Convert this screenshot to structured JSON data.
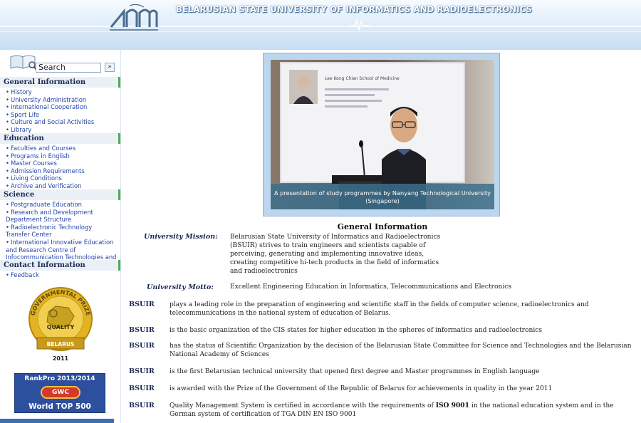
{
  "header": {
    "title": "BELARUSIAN STATE UNIVERSITY OF INFORMATICS AND RADIOELECTRONICS",
    "logo_icon": "bsuir-logo-icon"
  },
  "search": {
    "label": "Search",
    "go_label": "»"
  },
  "sidebar": {
    "sections": [
      {
        "title": "General Information",
        "items": [
          "History",
          "University Administration",
          "International Cooperation",
          "Sport Life",
          "Culture and Social Activities",
          "Library"
        ]
      },
      {
        "title": "Education",
        "items": [
          "Faculties and Courses",
          "Programs in English",
          "Master Courses",
          "Admission Requirements",
          "Living Conditions",
          "Archive and Verification"
        ]
      },
      {
        "title": "Science",
        "items": [
          "Postgraduate Education",
          "Research and Development Department Structure",
          "Radioelectronic Technology Transfer Center",
          "International Innovative Education and Research Centre of Infocommunication Technologies and Data Protection"
        ]
      },
      {
        "title": "Contact Information",
        "items": [
          "Feedback"
        ]
      }
    ]
  },
  "badges": {
    "gov_prize": {
      "top": "GOVERNMENTAL PRIZE",
      "mid": "QUALITY",
      "bottom": "BELARUS",
      "year": "2011"
    },
    "rankpro": {
      "title": "RankPro 2013/2014",
      "logo": "GWC",
      "subtitle": "World TOP 500"
    }
  },
  "photo": {
    "caption": "A presentation of study programmes by Nanyang Technological University (Singapore)",
    "slide_title": "Lee Kong Chian School of Medicine"
  },
  "main": {
    "title": "General Information",
    "mission_label": "University Mission:",
    "mission_text": "Belarusian State University of Informatics and Radioelectronics (BSUIR) strives to train engineers and scientists capable of perceiving, generating and implementing innovative ideas, creating competitive hi-tech products in the field of informatics and radioelectronics",
    "motto_label": "University Motto:",
    "motto_text": "Excellent Engineering Education in Informatics, Telecommunications and Electronics",
    "facts": [
      {
        "key": "BSUIR",
        "text": "plays a leading role in the preparation of engineering and scientific staff in the fields of computer science, radioelectronics and telecommunications in the national system of education of Belarus."
      },
      {
        "key": "BSUIR",
        "text": "is the basic organization of the CIS states for higher education in the spheres of informatics and radioelectronics"
      },
      {
        "key": "BSUIR",
        "text": "has the status of Scientific Organization by the decision of the Belarusian State Committee for Science and Technologies and the Belarusian National Academy of Sciences"
      },
      {
        "key": "BSUIR",
        "text": "is the first Belarusian technical university that opened first degree and Master programmes in English language"
      },
      {
        "key": "BSUIR",
        "text": "is awarded with the Prize of the Government of the Republic of Belarus for achievements in quality in the year 2011"
      },
      {
        "key": "BSUIR",
        "text_before": "Quality Management System is certified in accordance with the requirements of ",
        "text_bold": "ISO 9001",
        "text_after": " in the national education system and in the German system of certification of TGA DIN EN ISO 9001"
      }
    ]
  }
}
